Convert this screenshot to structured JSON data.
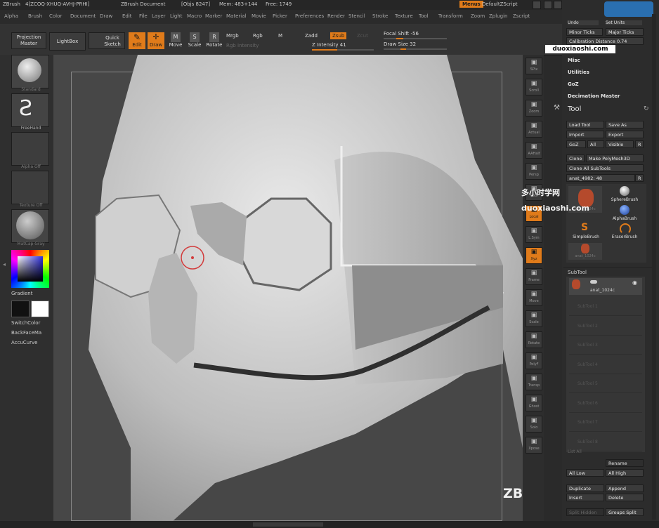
{
  "titlebar": {
    "app": "ZBrush",
    "code": "4[ZCOQ-XHUQ-AVHJ-PRHI]",
    "document": "ZBrush Document",
    "objs": "[Objs 8247]",
    "mem": "Mem: 483+144",
    "free": "Free: 1749",
    "menus_button": "Menus",
    "script": "DefaultZScript"
  },
  "menu": [
    "Alpha",
    "Brush",
    "Color",
    "Document",
    "Draw",
    "Edit",
    "File",
    "Layer",
    "Light",
    "Macro",
    "Marker",
    "Material",
    "Movie",
    "Picker",
    "Preferences",
    "Render",
    "Stencil",
    "Stroke",
    "Texture",
    "Tool",
    "Transform",
    "Zoom",
    "Zplugin",
    "Zscript"
  ],
  "toolbar": {
    "projection_master": "Projection Master",
    "lightbox": "LightBox",
    "quick_sketch": "Quick Sketch",
    "edit": "Edit",
    "draw": "Draw",
    "move": "Move",
    "scale": "Scale",
    "rotate": "Rotate",
    "mrgb": "Mrgb",
    "rgb": "Rgb",
    "m": "M",
    "rgb_intensity": "Rgb Intensity",
    "zadd": "Zadd",
    "zsub": "Zsub",
    "zcut": "Zcut",
    "z_intensity_label": "Z Intensity",
    "z_intensity": "41",
    "focal_shift_label": "Focal Shift",
    "focal_shift": "-56",
    "draw_size_label": "Draw Size",
    "draw_size": "32"
  },
  "left_shelf": {
    "brush": "Standard",
    "stroke": "FreeHand",
    "alpha": "Alpha Off",
    "texture": "Texture Off",
    "material": "MatCap Gray",
    "gradient": "Gradient",
    "switch_color": "SwitchColor",
    "backface": "BackFaceMa",
    "alternate": "AccuCurve"
  },
  "right_shelf": [
    "SPix",
    "Scroll",
    "Zoom",
    "Actual",
    "AAHalf",
    "Persp",
    "Floor",
    "Local",
    "L.Sym",
    "Xyz",
    "Frame",
    "Move",
    "Scale",
    "Rotate",
    "PolyF",
    "Transp",
    "Ghost",
    "Solo",
    "Xpose"
  ],
  "panel": {
    "top_buttons": [
      "Undo",
      "Set Units",
      "Minor Ticks",
      "Major Ticks"
    ],
    "calibration_distance_label": "Calibration Distance",
    "calibration_distance": "0.74",
    "sections": [
      "Misc",
      "Utilities",
      "GoZ",
      "Decimation Master"
    ],
    "tool_title": "Tool",
    "load_tool": "Load Tool",
    "save_as": "Save As",
    "import": "Import",
    "export": "Export",
    "goz": "GoZ",
    "all": "All",
    "visible": "Visible",
    "r": "R",
    "clone": "Clone",
    "make_polymesh": "Make PolyMesh3D",
    "clone_all": "Clone All SubTools",
    "tool_name": "anat_4982: 48",
    "tools": [
      "anat_1024c",
      "SphereBrush",
      "AlphaBrush",
      "SimpleBrush",
      "EraserBrush",
      "anat_1024c"
    ],
    "subtool_title": "SubTool",
    "subtool_active": "anat_1024c",
    "subtool_slots": [
      "SubTool 1",
      "SubTool 2",
      "SubTool 3",
      "SubTool 4",
      "SubTool 5",
      "SubTool 6",
      "SubTool 7",
      "SubTool 8"
    ],
    "list_all": "List All",
    "rename": "Rename",
    "all_low": "All Low",
    "all_high": "All High",
    "duplicate": "Duplicate",
    "append": "Append",
    "insert": "Insert",
    "delete": "Delete",
    "split_hidden": "Split Hidden",
    "groups_split": "Groups Split"
  },
  "watermarks": {
    "site_top": "duoxiaoshi.com",
    "site_cn": "多小时学网",
    "site_mid": "duoxiaoshi.com",
    "workshops": "ZBrushWorkshops"
  },
  "colors": {
    "accent": "#e07b1a",
    "canvas_bg": "#474747"
  }
}
